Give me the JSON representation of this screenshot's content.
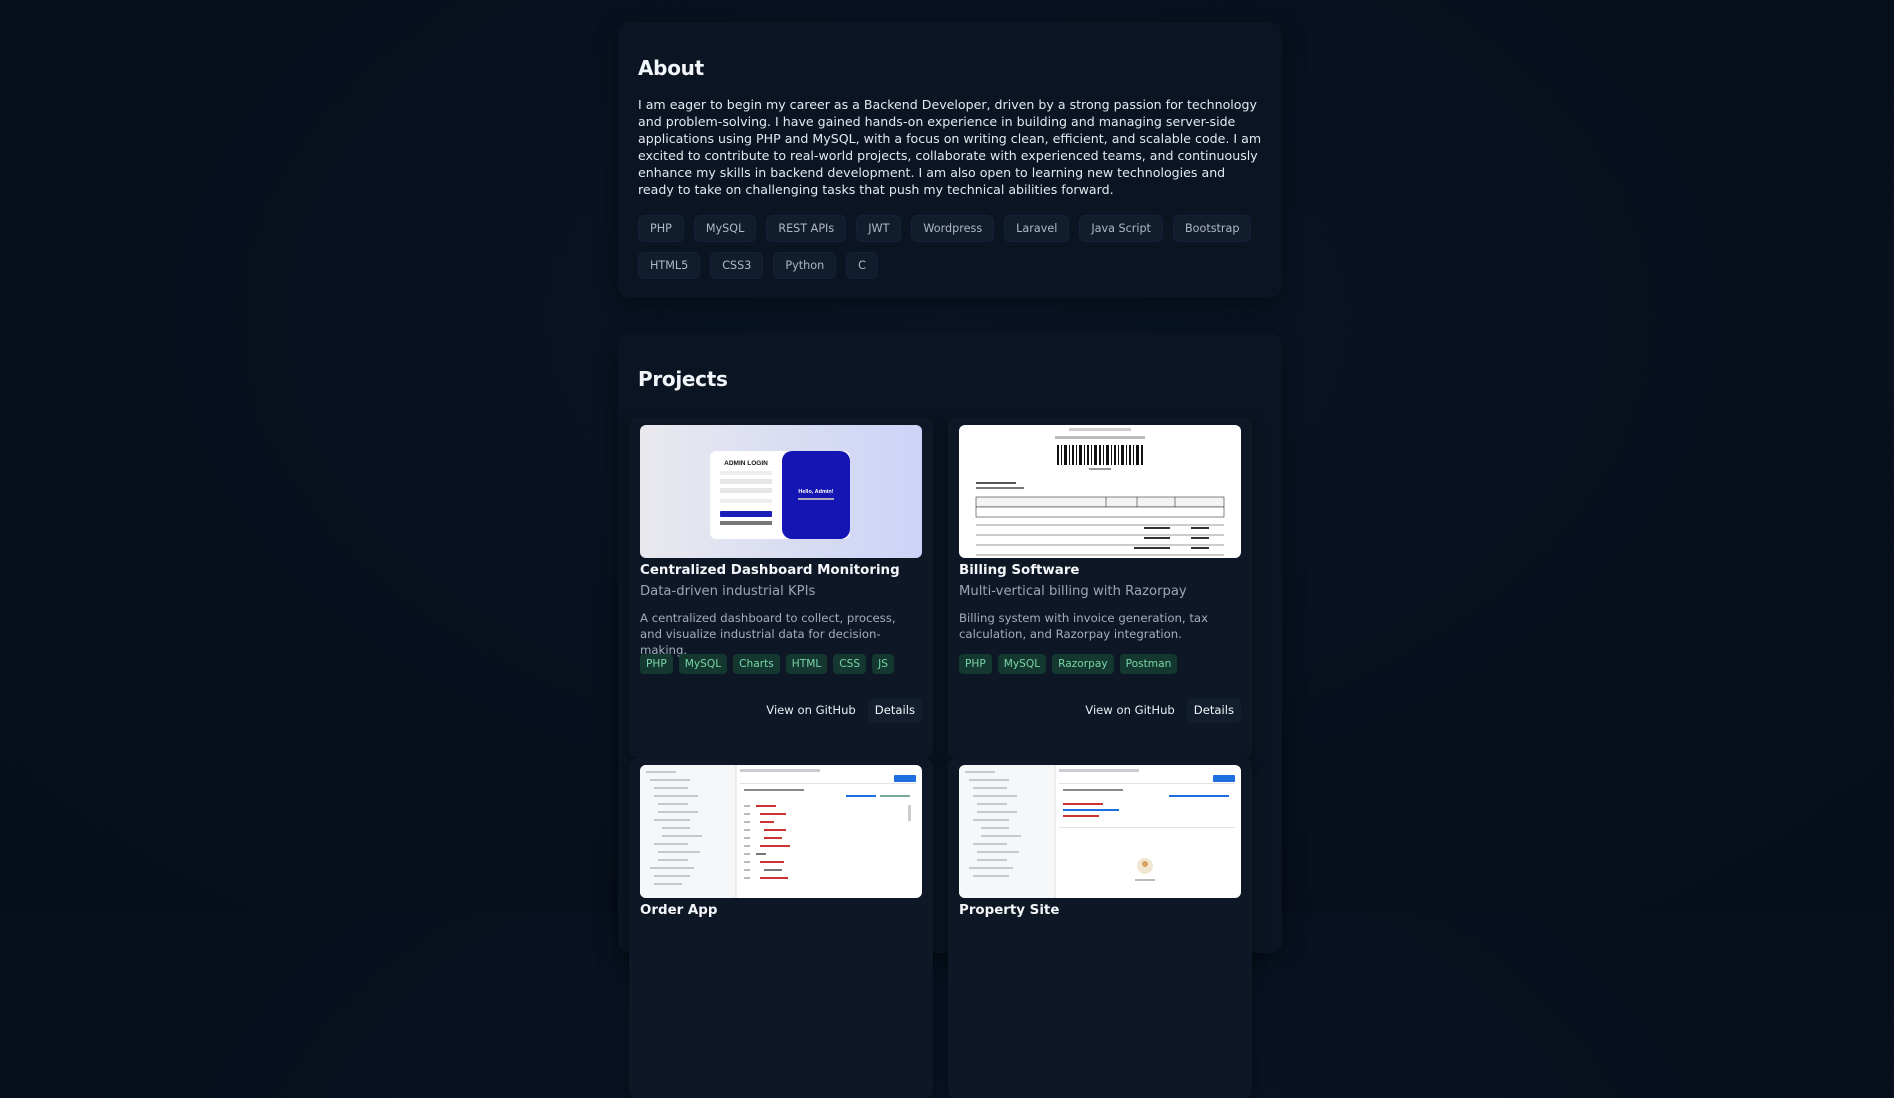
{
  "about": {
    "heading": "About",
    "text": "I am eager to begin my career as a Backend Developer, driven by a strong passion for technology and problem-solving. I have gained hands-on experience in building and managing server-side applications using PHP and MySQL, with a focus on writing clean, efficient, and scalable code. I am excited to contribute to real-world projects, collaborate with experienced teams, and continuously enhance my skills in backend development. I am also open to learning new technologies and ready to take on challenging tasks that push my technical abilities forward.",
    "skills": [
      "PHP",
      "MySQL",
      "REST APIs",
      "JWT",
      "Wordpress",
      "Laravel",
      "Java Script",
      "Bootstrap",
      "HTML5",
      "CSS3",
      "Python",
      "C"
    ]
  },
  "projects": {
    "heading": "Projects",
    "items": [
      {
        "title": "Centralized Dashboard Monitoring",
        "subtitle": "Data-driven industrial KPIs",
        "description": "A centralized dashboard to collect, process, and visualize industrial data for decision-making.",
        "tags": [
          "PHP",
          "MySQL",
          "Charts",
          "HTML",
          "CSS",
          "JS"
        ],
        "github_label": "View on GitHub",
        "details_label": "Details",
        "thumb": {
          "login_title": "ADMIN LOGIN",
          "welcome": "Hello, Admin!"
        }
      },
      {
        "title": "Billing Software",
        "subtitle": "Multi-vertical billing with Razorpay",
        "description": "Billing system with invoice generation, tax calculation, and Razorpay integration.",
        "tags": [
          "PHP",
          "MySQL",
          "Razorpay",
          "Postman"
        ],
        "github_label": "View on GitHub",
        "details_label": "Details"
      },
      {
        "title": "Order App",
        "subtitle": "",
        "description": "",
        "tags": []
      },
      {
        "title": "Property Site",
        "subtitle": "",
        "description": "",
        "tags": []
      }
    ]
  },
  "colors": {
    "background": "#07101d",
    "card": "#0b1422",
    "tag_bg": "#14382f",
    "tag_text": "#79d4a8",
    "accent_blue": "#1a1fb8"
  }
}
